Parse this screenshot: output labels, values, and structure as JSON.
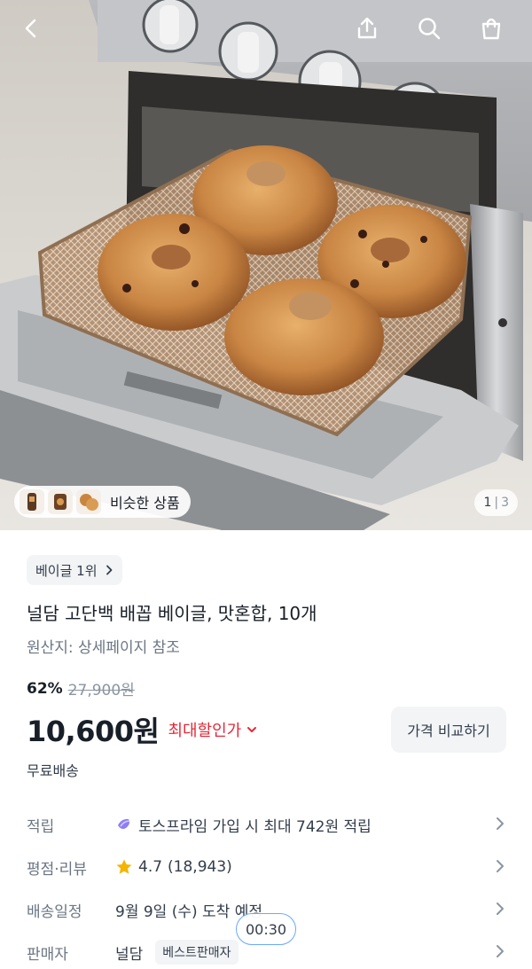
{
  "hero": {
    "similar_label": "비슷한 상품",
    "page_current": "1",
    "page_separator": "|",
    "page_total": "3"
  },
  "product": {
    "rank_badge": "베이글 1위",
    "title": "널담 고단백 배꼽 베이글, 맛혼합, 10개",
    "origin": "원산지: 상세페이지 참조",
    "discount_rate": "62%",
    "original_price": "27,900원",
    "price": "10,600원",
    "max_discount_label": "최대할인가",
    "compare_button": "가격 비교하기",
    "shipping": "무료배송"
  },
  "info_rows": {
    "points_label": "적립",
    "points_value": "토스프라임 가입 시 최대 742원 적립",
    "rating_label": "평점·리뷰",
    "rating_value": "4.7",
    "review_count": "(18,943)",
    "delivery_label": "배송일정",
    "delivery_value": "9월 9일 (수) 도착 예정",
    "seller_label": "판매자",
    "seller_value": "널담",
    "seller_badge": "베스트판매자"
  },
  "overlay": {
    "timer": "00:30"
  },
  "colors": {
    "accent_red": "#e42939",
    "star": "#f5b400",
    "text": "#191f28",
    "subtext": "#6b7684"
  }
}
